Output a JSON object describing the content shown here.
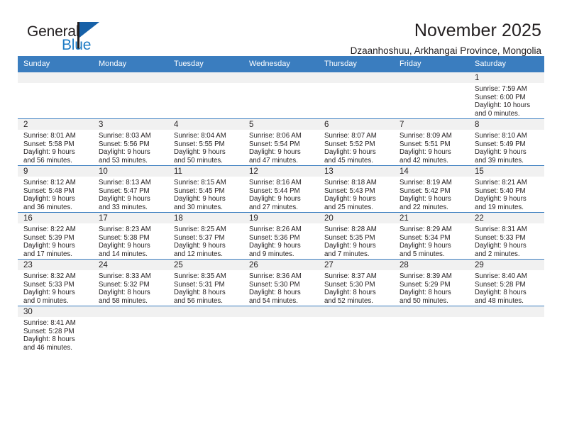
{
  "brand": {
    "name_part1": "General",
    "name_part2": "Blue",
    "logo_icon": "blue-flag-logo"
  },
  "header": {
    "month_title": "November 2025",
    "location": "Dzaanhoshuu, Arkhangai Province, Mongolia"
  },
  "calendar": {
    "weekday_headers": [
      "Sunday",
      "Monday",
      "Tuesday",
      "Wednesday",
      "Thursday",
      "Friday",
      "Saturday"
    ],
    "accent_color": "#3a7dbf",
    "daynum_bg": "#f1f1f1",
    "weeks": [
      [
        {
          "empty": true
        },
        {
          "empty": true
        },
        {
          "empty": true
        },
        {
          "empty": true
        },
        {
          "empty": true
        },
        {
          "empty": true
        },
        {
          "day": "1",
          "sunrise": "Sunrise: 7:59 AM",
          "sunset": "Sunset: 6:00 PM",
          "daylight_1": "Daylight: 10 hours",
          "daylight_2": "and 0 minutes."
        }
      ],
      [
        {
          "day": "2",
          "sunrise": "Sunrise: 8:01 AM",
          "sunset": "Sunset: 5:58 PM",
          "daylight_1": "Daylight: 9 hours",
          "daylight_2": "and 56 minutes."
        },
        {
          "day": "3",
          "sunrise": "Sunrise: 8:03 AM",
          "sunset": "Sunset: 5:56 PM",
          "daylight_1": "Daylight: 9 hours",
          "daylight_2": "and 53 minutes."
        },
        {
          "day": "4",
          "sunrise": "Sunrise: 8:04 AM",
          "sunset": "Sunset: 5:55 PM",
          "daylight_1": "Daylight: 9 hours",
          "daylight_2": "and 50 minutes."
        },
        {
          "day": "5",
          "sunrise": "Sunrise: 8:06 AM",
          "sunset": "Sunset: 5:54 PM",
          "daylight_1": "Daylight: 9 hours",
          "daylight_2": "and 47 minutes."
        },
        {
          "day": "6",
          "sunrise": "Sunrise: 8:07 AM",
          "sunset": "Sunset: 5:52 PM",
          "daylight_1": "Daylight: 9 hours",
          "daylight_2": "and 45 minutes."
        },
        {
          "day": "7",
          "sunrise": "Sunrise: 8:09 AM",
          "sunset": "Sunset: 5:51 PM",
          "daylight_1": "Daylight: 9 hours",
          "daylight_2": "and 42 minutes."
        },
        {
          "day": "8",
          "sunrise": "Sunrise: 8:10 AM",
          "sunset": "Sunset: 5:49 PM",
          "daylight_1": "Daylight: 9 hours",
          "daylight_2": "and 39 minutes."
        }
      ],
      [
        {
          "day": "9",
          "sunrise": "Sunrise: 8:12 AM",
          "sunset": "Sunset: 5:48 PM",
          "daylight_1": "Daylight: 9 hours",
          "daylight_2": "and 36 minutes."
        },
        {
          "day": "10",
          "sunrise": "Sunrise: 8:13 AM",
          "sunset": "Sunset: 5:47 PM",
          "daylight_1": "Daylight: 9 hours",
          "daylight_2": "and 33 minutes."
        },
        {
          "day": "11",
          "sunrise": "Sunrise: 8:15 AM",
          "sunset": "Sunset: 5:45 PM",
          "daylight_1": "Daylight: 9 hours",
          "daylight_2": "and 30 minutes."
        },
        {
          "day": "12",
          "sunrise": "Sunrise: 8:16 AM",
          "sunset": "Sunset: 5:44 PM",
          "daylight_1": "Daylight: 9 hours",
          "daylight_2": "and 27 minutes."
        },
        {
          "day": "13",
          "sunrise": "Sunrise: 8:18 AM",
          "sunset": "Sunset: 5:43 PM",
          "daylight_1": "Daylight: 9 hours",
          "daylight_2": "and 25 minutes."
        },
        {
          "day": "14",
          "sunrise": "Sunrise: 8:19 AM",
          "sunset": "Sunset: 5:42 PM",
          "daylight_1": "Daylight: 9 hours",
          "daylight_2": "and 22 minutes."
        },
        {
          "day": "15",
          "sunrise": "Sunrise: 8:21 AM",
          "sunset": "Sunset: 5:40 PM",
          "daylight_1": "Daylight: 9 hours",
          "daylight_2": "and 19 minutes."
        }
      ],
      [
        {
          "day": "16",
          "sunrise": "Sunrise: 8:22 AM",
          "sunset": "Sunset: 5:39 PM",
          "daylight_1": "Daylight: 9 hours",
          "daylight_2": "and 17 minutes."
        },
        {
          "day": "17",
          "sunrise": "Sunrise: 8:23 AM",
          "sunset": "Sunset: 5:38 PM",
          "daylight_1": "Daylight: 9 hours",
          "daylight_2": "and 14 minutes."
        },
        {
          "day": "18",
          "sunrise": "Sunrise: 8:25 AM",
          "sunset": "Sunset: 5:37 PM",
          "daylight_1": "Daylight: 9 hours",
          "daylight_2": "and 12 minutes."
        },
        {
          "day": "19",
          "sunrise": "Sunrise: 8:26 AM",
          "sunset": "Sunset: 5:36 PM",
          "daylight_1": "Daylight: 9 hours",
          "daylight_2": "and 9 minutes."
        },
        {
          "day": "20",
          "sunrise": "Sunrise: 8:28 AM",
          "sunset": "Sunset: 5:35 PM",
          "daylight_1": "Daylight: 9 hours",
          "daylight_2": "and 7 minutes."
        },
        {
          "day": "21",
          "sunrise": "Sunrise: 8:29 AM",
          "sunset": "Sunset: 5:34 PM",
          "daylight_1": "Daylight: 9 hours",
          "daylight_2": "and 5 minutes."
        },
        {
          "day": "22",
          "sunrise": "Sunrise: 8:31 AM",
          "sunset": "Sunset: 5:33 PM",
          "daylight_1": "Daylight: 9 hours",
          "daylight_2": "and 2 minutes."
        }
      ],
      [
        {
          "day": "23",
          "sunrise": "Sunrise: 8:32 AM",
          "sunset": "Sunset: 5:33 PM",
          "daylight_1": "Daylight: 9 hours",
          "daylight_2": "and 0 minutes."
        },
        {
          "day": "24",
          "sunrise": "Sunrise: 8:33 AM",
          "sunset": "Sunset: 5:32 PM",
          "daylight_1": "Daylight: 8 hours",
          "daylight_2": "and 58 minutes."
        },
        {
          "day": "25",
          "sunrise": "Sunrise: 8:35 AM",
          "sunset": "Sunset: 5:31 PM",
          "daylight_1": "Daylight: 8 hours",
          "daylight_2": "and 56 minutes."
        },
        {
          "day": "26",
          "sunrise": "Sunrise: 8:36 AM",
          "sunset": "Sunset: 5:30 PM",
          "daylight_1": "Daylight: 8 hours",
          "daylight_2": "and 54 minutes."
        },
        {
          "day": "27",
          "sunrise": "Sunrise: 8:37 AM",
          "sunset": "Sunset: 5:30 PM",
          "daylight_1": "Daylight: 8 hours",
          "daylight_2": "and 52 minutes."
        },
        {
          "day": "28",
          "sunrise": "Sunrise: 8:39 AM",
          "sunset": "Sunset: 5:29 PM",
          "daylight_1": "Daylight: 8 hours",
          "daylight_2": "and 50 minutes."
        },
        {
          "day": "29",
          "sunrise": "Sunrise: 8:40 AM",
          "sunset": "Sunset: 5:28 PM",
          "daylight_1": "Daylight: 8 hours",
          "daylight_2": "and 48 minutes."
        }
      ],
      [
        {
          "day": "30",
          "sunrise": "Sunrise: 8:41 AM",
          "sunset": "Sunset: 5:28 PM",
          "daylight_1": "Daylight: 8 hours",
          "daylight_2": "and 46 minutes."
        },
        {
          "empty": true
        },
        {
          "empty": true
        },
        {
          "empty": true
        },
        {
          "empty": true
        },
        {
          "empty": true
        },
        {
          "empty": true
        }
      ]
    ]
  }
}
